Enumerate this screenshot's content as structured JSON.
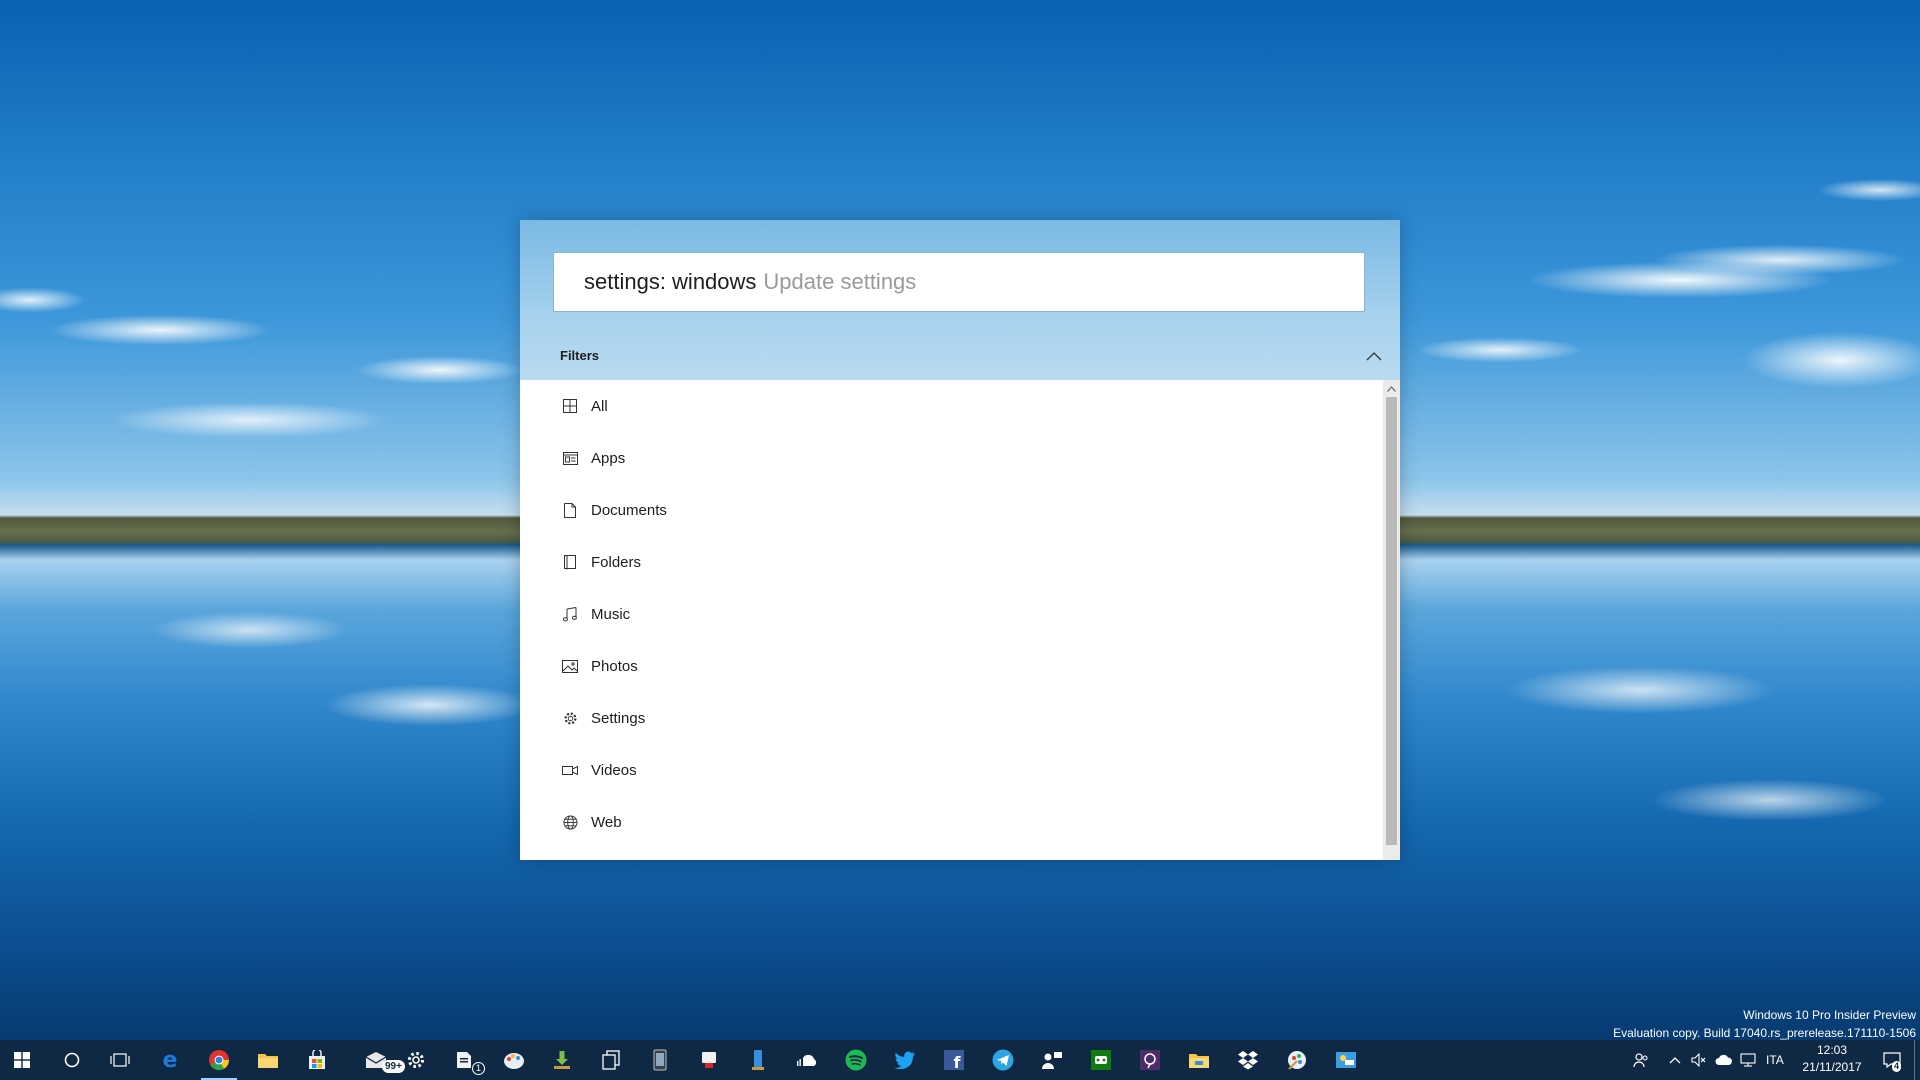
{
  "search": {
    "typed_text": "settings: windows",
    "suggestion_text": "Update settings"
  },
  "filters": {
    "header_label": "Filters",
    "items": [
      {
        "label": "All",
        "icon": "grid-icon"
      },
      {
        "label": "Apps",
        "icon": "app-window-icon"
      },
      {
        "label": "Documents",
        "icon": "document-icon"
      },
      {
        "label": "Folders",
        "icon": "folder-icon"
      },
      {
        "label": "Music",
        "icon": "music-note-icon"
      },
      {
        "label": "Photos",
        "icon": "photo-icon"
      },
      {
        "label": "Settings",
        "icon": "gear-icon"
      },
      {
        "label": "Videos",
        "icon": "video-camera-icon"
      },
      {
        "label": "Web",
        "icon": "globe-icon"
      }
    ]
  },
  "watermark": {
    "line1": "Windows 10 Pro Insider Preview",
    "line2": "Evaluation copy. Build 17040.rs_prerelease.171110-1506"
  },
  "taskbar": {
    "pinned": [
      "windows-start-icon",
      "cortana-circle-icon",
      "task-view-icon",
      "edge-icon",
      "chrome-icon",
      "file-explorer-icon",
      "store-icon",
      "mail-icon",
      "settings-gear-icon",
      "news-icon",
      "paint-icon",
      "download-icon",
      "documents-icon",
      "phone-icon",
      "messaging-icon",
      "tablet-icon",
      "soundcloud-icon",
      "spotify-icon",
      "twitter-icon",
      "facebook-icon",
      "telegram-icon",
      "people-icon",
      "xbox-icon",
      "feedback-icon",
      "folder-icon",
      "dropbox-icon",
      "paint3d-icon",
      "weather-icon"
    ],
    "mail_badge": "99+",
    "news_badge": "1",
    "tray": {
      "language": "ITA",
      "time": "12:03",
      "date": "21/11/2017",
      "notification_count": "4"
    },
    "colors": {
      "taskbar_bg": "#10283f",
      "accent": "#9fd0ff",
      "spotify": "#1db954",
      "twitter": "#1da1f2",
      "facebook": "#3b5998",
      "edge": "#1d7ad9"
    }
  }
}
